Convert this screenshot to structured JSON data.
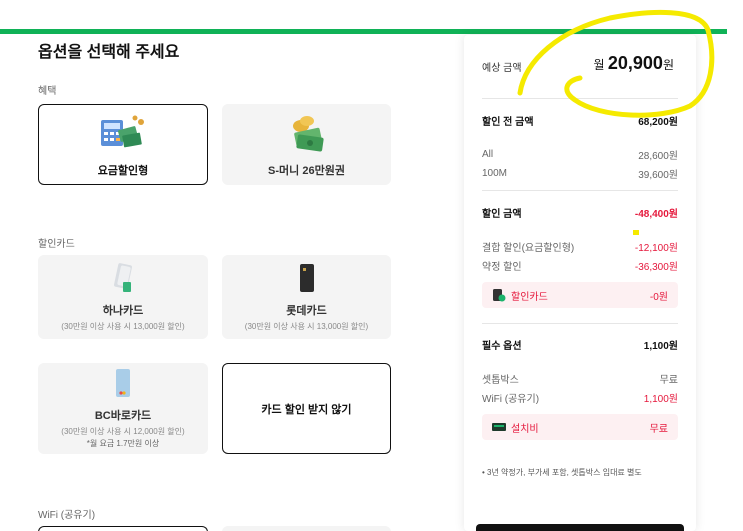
{
  "title": "옵션을 선택해 주세요",
  "sections": {
    "benefit": "혜택",
    "discount_card": "할인카드",
    "wifi": "WiFi (공유기)"
  },
  "benefit_options": [
    {
      "name": "요금할인형",
      "icon": "money-calculator-icon",
      "selected": true
    },
    {
      "name": "S-머니 26만원권",
      "icon": "money-coins-icon",
      "selected": false
    }
  ],
  "card_options": [
    {
      "name": "하나카드",
      "sub": "(30만원 이상 사용 시 13,000원 할인)",
      "icon": "hana-card-icon"
    },
    {
      "name": "롯데카드",
      "sub": "(30만원 이상 사용 시 13,000원 할인)",
      "icon": "lotte-card-icon"
    },
    {
      "name": "BC바로카드",
      "sub": "(30만원 이상 사용 시 12,000원 할인)",
      "sub2": "*월 요금 1.7만원 이상",
      "icon": "bc-card-icon"
    },
    {
      "name": "카드 할인 받지 않기",
      "selected": true
    }
  ],
  "summary": {
    "estimate_label": "예상 금액",
    "estimate_prefix": "월",
    "estimate_value": "20,900",
    "estimate_unit": "원",
    "before_label": "할인 전 금액",
    "before_value": "68,200원",
    "all_label": "All",
    "all_value": "28,600원",
    "m100_label": "100M",
    "m100_value": "39,600원",
    "discount_label": "할인 금액",
    "discount_value": "-48,400원",
    "combo_label": "결합 할인(요금할인형)",
    "combo_value": "-12,100원",
    "contract_label": "약정 할인",
    "contract_value": "-36,300원",
    "card_label": "할인카드",
    "card_value": "-0원",
    "required_label": "필수 옵션",
    "required_value": "1,100원",
    "settop_label": "셋톱박스",
    "settop_value": "무료",
    "wifi_label": "WiFi (공유기)",
    "wifi_value": "1,100원",
    "install_label": "설치비",
    "install_value": "무료",
    "note": "• 3년 약정가, 부가세 포함, 셋톱박스 임대료 별도"
  },
  "colors": {
    "accent_green": "#10b257",
    "discount_red": "#e5183c",
    "highlight_yellow": "#f5ea00"
  }
}
